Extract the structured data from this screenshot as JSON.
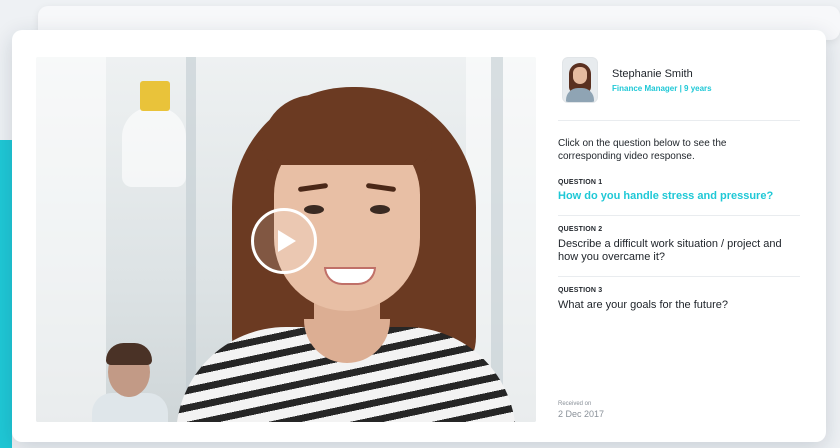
{
  "profile": {
    "name": "Stephanie Smith",
    "role": "Finance Manager | 9 years"
  },
  "intro": "Click on the question below to see the corresponding video response.",
  "questions": [
    {
      "label": "QUESTION 1",
      "text": "How do you handle stress and pressure?",
      "active": true
    },
    {
      "label": "QUESTION 2",
      "text": "Describe a difficult work situation / project and how you overcame it?",
      "active": false
    },
    {
      "label": "QUESTION 3",
      "text": "What are your goals for the future?",
      "active": false
    }
  ],
  "received": {
    "label": "Received on",
    "date": "2 Dec 2017"
  },
  "video": {
    "play_icon": "play-icon"
  },
  "colors": {
    "accent": "#1fc8d6",
    "text": "#1e2329",
    "muted": "#8a9199"
  }
}
